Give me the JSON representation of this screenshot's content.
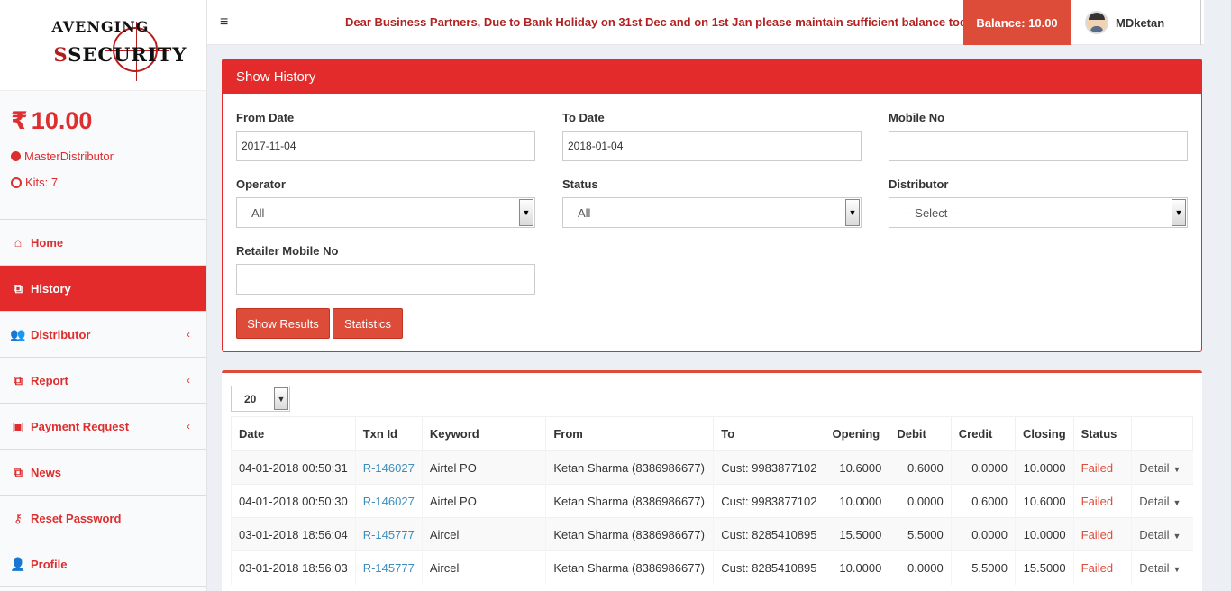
{
  "brand": {
    "line1": "VENGING",
    "line2": "SECURITY",
    "lead_letter_1": "A",
    "lead_letter_2": "S"
  },
  "sidebar": {
    "balance": "10.00",
    "currency_symbol": "₹",
    "role": "MasterDistributor",
    "kits": "Kits: 7",
    "items": [
      {
        "label": "Home",
        "icon": "home-icon",
        "glyph": "⌂"
      },
      {
        "label": "History",
        "icon": "copy-icon",
        "glyph": "⧉",
        "active": true
      },
      {
        "label": "Distributor",
        "icon": "users-icon",
        "glyph": "👥",
        "chevron": "‹"
      },
      {
        "label": "Report",
        "icon": "copy-icon",
        "glyph": "⧉",
        "chevron": "‹"
      },
      {
        "label": "Payment Request",
        "icon": "money-icon",
        "glyph": "▣",
        "chevron": "‹"
      },
      {
        "label": "News",
        "icon": "copy-icon",
        "glyph": "⧉"
      },
      {
        "label": "Reset Password",
        "icon": "key-icon",
        "glyph": "⚷"
      },
      {
        "label": "Profile",
        "icon": "user-icon",
        "glyph": "👤"
      }
    ]
  },
  "header": {
    "menu_glyph": "≡",
    "notice": "Dear Business Partners, Due to Bank Holiday on 31st Dec and on 1st Jan please maintain sufficient balance today",
    "balance_label": "Balance: 10.00",
    "username": "MDketan"
  },
  "filters": {
    "title": "Show History",
    "from_date_label": "From Date",
    "from_date_value": "2017-11-04",
    "to_date_label": "To Date",
    "to_date_value": "2018-01-04",
    "mobile_label": "Mobile No",
    "mobile_value": "",
    "operator_label": "Operator",
    "operator_value": "All",
    "status_label": "Status",
    "status_value": "All",
    "distributor_label": "Distributor",
    "distributor_value": "-- Select --",
    "retailer_label": "Retailer Mobile No",
    "retailer_value": "",
    "show_results": "Show Results",
    "statistics": "Statistics",
    "select_arrow": "▼"
  },
  "results": {
    "page_size": "20",
    "columns": [
      "Date",
      "Txn Id",
      "Keyword",
      "From",
      "To",
      "Opening",
      "Debit",
      "Credit",
      "Closing",
      "Status",
      ""
    ],
    "rows": [
      {
        "date": "04-01-2018 00:50:31",
        "txn": "R-146027",
        "keyword": "Airtel PO",
        "from": "Ketan Sharma (8386986677)",
        "to": "Cust: 9983877102",
        "opening": "10.6000",
        "debit": "0.6000",
        "credit": "0.0000",
        "closing": "10.0000",
        "status": "Failed",
        "detail": "Detail"
      },
      {
        "date": "04-01-2018 00:50:30",
        "txn": "R-146027",
        "keyword": "Airtel PO",
        "from": "Ketan Sharma (8386986677)",
        "to": "Cust: 9983877102",
        "opening": "10.0000",
        "debit": "0.0000",
        "credit": "0.6000",
        "closing": "10.6000",
        "status": "Failed",
        "detail": "Detail"
      },
      {
        "date": "03-01-2018 18:56:04",
        "txn": "R-145777",
        "keyword": "Aircel",
        "from": "Ketan Sharma (8386986677)",
        "to": "Cust: 8285410895",
        "opening": "15.5000",
        "debit": "5.5000",
        "credit": "0.0000",
        "closing": "10.0000",
        "status": "Failed",
        "detail": "Detail"
      },
      {
        "date": "03-01-2018 18:56:03",
        "txn": "R-145777",
        "keyword": "Aircel",
        "from": "Ketan Sharma (8386986677)",
        "to": "Cust: 8285410895",
        "opening": "10.0000",
        "debit": "0.0000",
        "credit": "5.5000",
        "closing": "15.5000",
        "status": "Failed",
        "detail": "Detail"
      }
    ],
    "caret": "▼"
  },
  "colors": {
    "accent": "#e42b2b",
    "button": "#dd4b39",
    "link": "#3c8dbc"
  }
}
